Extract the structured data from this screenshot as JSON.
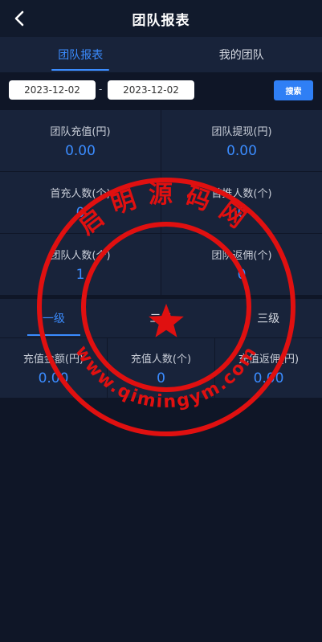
{
  "header": {
    "title": "团队报表",
    "back_icon": "chevron-left-icon"
  },
  "tabs": [
    {
      "label": "团队报表",
      "active": true
    },
    {
      "label": "我的团队",
      "active": false
    }
  ],
  "filter": {
    "start_date": "2023-12-02",
    "end_date": "2023-12-02",
    "separator": "-",
    "search_label": "搜索"
  },
  "stats": [
    {
      "label": "团队充值(円)",
      "value": "0.00"
    },
    {
      "label": "团队提现(円)",
      "value": "0.00"
    },
    {
      "label": "首充人数(个)",
      "value": "0"
    },
    {
      "label": "首推人数(个)",
      "value": "0"
    },
    {
      "label": "团队人数(个)",
      "value": "1"
    },
    {
      "label": "团队返佣(个)",
      "value": "0"
    }
  ],
  "levels": [
    {
      "label": "一级",
      "active": true
    },
    {
      "label": "二级",
      "active": false
    },
    {
      "label": "三级",
      "active": false
    }
  ],
  "summary": [
    {
      "label": "充值金额(円)",
      "value": "0.00"
    },
    {
      "label": "充值人数(个)",
      "value": "0"
    },
    {
      "label": "充值返佣(円)",
      "value": "0.00"
    }
  ],
  "watermark": {
    "top_text": "启明源码网",
    "bottom_text": "www.qimingym.com",
    "color": "#e01010"
  },
  "colors": {
    "accent": "#3b8cff",
    "background": "#0f1627",
    "panel": "#18233a"
  }
}
